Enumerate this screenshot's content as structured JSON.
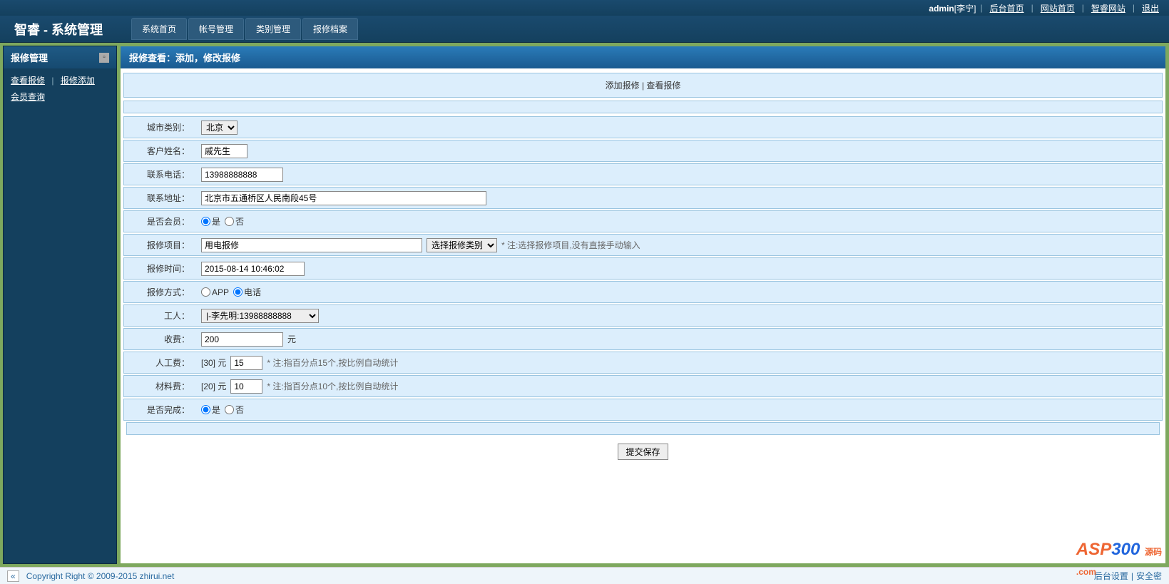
{
  "topbar": {
    "user_prefix": "admin",
    "user_name": "[李宁]",
    "links": [
      "后台首页",
      "网站首页",
      "智睿网站",
      "退出"
    ]
  },
  "logo": "智睿 - 系统管理",
  "mainnav": [
    "系统首页",
    "帐号管理",
    "类别管理",
    "报修档案"
  ],
  "sidebar": {
    "title": "报修管理",
    "row1": [
      "查看报修",
      "报修添加"
    ],
    "row2": [
      "会员查询"
    ]
  },
  "content_title": "报修查看：添加，修改报修",
  "toolbar": {
    "add": "添加报修",
    "view": "查看报修"
  },
  "form": {
    "city": {
      "label": "城市类别：",
      "value": "北京"
    },
    "name": {
      "label": "客户姓名：",
      "value": "戚先生"
    },
    "phone": {
      "label": "联系电话：",
      "value": "13988888888"
    },
    "address": {
      "label": "联系地址：",
      "value": "北京市五通桥区人民南段45号"
    },
    "member": {
      "label": "是否会员：",
      "yes": "是",
      "no": "否"
    },
    "project": {
      "label": "报修项目：",
      "value": "用电报修",
      "select": "选择报修类别",
      "note": "* 注:选择报修项目,没有直接手动输入"
    },
    "time": {
      "label": "报修时间：",
      "value": "2015-08-14 10:46:02"
    },
    "method": {
      "label": "报修方式：",
      "app": "APP",
      "phone": "电话"
    },
    "worker": {
      "label": "工人：",
      "value": "|-李先明:13988888888"
    },
    "fee": {
      "label": "收费：",
      "value": "200",
      "unit": "元"
    },
    "labor": {
      "label": "人工费：",
      "prefix": "[30] 元",
      "value": "15",
      "note": "* 注:指百分点15个,按比例自动统计"
    },
    "material": {
      "label": "材料费：",
      "prefix": "[20] 元",
      "value": "10",
      "note": "* 注:指百分点10个,按比例自动统计"
    },
    "done": {
      "label": "是否完成：",
      "yes": "是",
      "no": "否"
    }
  },
  "submit": "提交保存",
  "footer": {
    "copyright": "Copyright Right © 2009-2015 zhirui.net",
    "right": [
      "后台设置",
      "安全密"
    ]
  },
  "watermark": {
    "a": "ASP",
    "b": "300",
    "c": "源码",
    "d": ".com"
  }
}
